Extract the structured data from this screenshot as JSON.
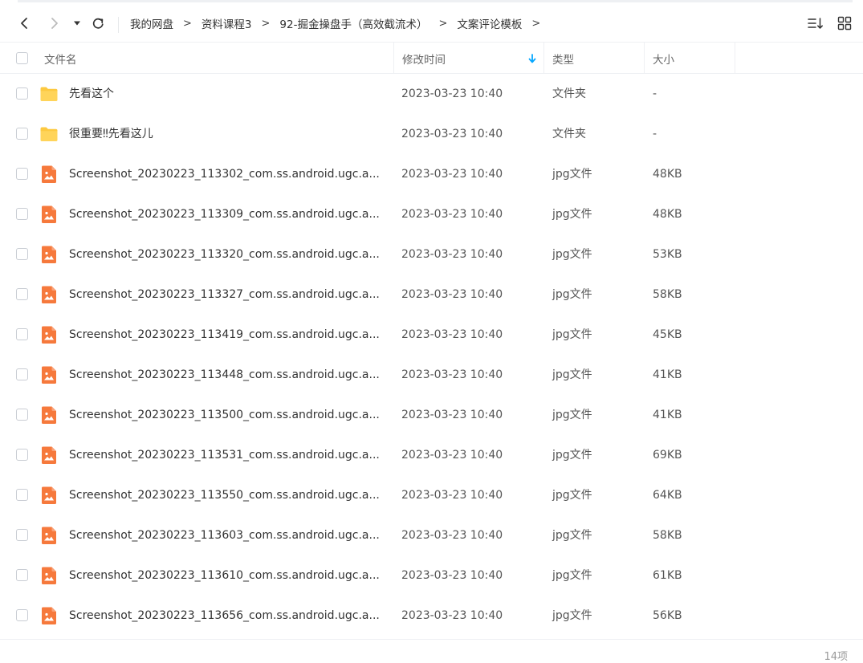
{
  "toolbar": {
    "back_icon": "chevron-left-icon",
    "forward_icon": "chevron-right-icon",
    "dropdown_icon": "caret-down-icon",
    "refresh_icon": "refresh-icon",
    "sort_icon": "sort-list-icon",
    "grid_icon": "grid-view-icon"
  },
  "breadcrumb": [
    {
      "label": "我的网盘"
    },
    {
      "label": "资料课程3"
    },
    {
      "label": "92-掘金操盘手（高效截流术）"
    },
    {
      "label": "文案评论模板"
    }
  ],
  "header": {
    "name": "文件名",
    "modified": "修改时间",
    "type": "类型",
    "size": "大小",
    "sort_indicator": "arrow-down-icon",
    "accent": "#06a7ff"
  },
  "files": [
    {
      "name": "先看这个",
      "date": "2023-03-23 10:40",
      "type": "文件夹",
      "size": "-",
      "icon": "folder-icon"
    },
    {
      "name": "很重要‼先看这儿",
      "date": "2023-03-23 10:40",
      "type": "文件夹",
      "size": "-",
      "icon": "folder-icon"
    },
    {
      "name": "Screenshot_20230223_113302_com.ss.android.ugc.a...",
      "date": "2023-03-23 10:40",
      "type": "jpg文件",
      "size": "48KB",
      "icon": "image-file-icon"
    },
    {
      "name": "Screenshot_20230223_113309_com.ss.android.ugc.a...",
      "date": "2023-03-23 10:40",
      "type": "jpg文件",
      "size": "48KB",
      "icon": "image-file-icon"
    },
    {
      "name": "Screenshot_20230223_113320_com.ss.android.ugc.a...",
      "date": "2023-03-23 10:40",
      "type": "jpg文件",
      "size": "53KB",
      "icon": "image-file-icon"
    },
    {
      "name": "Screenshot_20230223_113327_com.ss.android.ugc.a...",
      "date": "2023-03-23 10:40",
      "type": "jpg文件",
      "size": "58KB",
      "icon": "image-file-icon"
    },
    {
      "name": "Screenshot_20230223_113419_com.ss.android.ugc.a...",
      "date": "2023-03-23 10:40",
      "type": "jpg文件",
      "size": "45KB",
      "icon": "image-file-icon"
    },
    {
      "name": "Screenshot_20230223_113448_com.ss.android.ugc.a...",
      "date": "2023-03-23 10:40",
      "type": "jpg文件",
      "size": "41KB",
      "icon": "image-file-icon"
    },
    {
      "name": "Screenshot_20230223_113500_com.ss.android.ugc.a...",
      "date": "2023-03-23 10:40",
      "type": "jpg文件",
      "size": "41KB",
      "icon": "image-file-icon"
    },
    {
      "name": "Screenshot_20230223_113531_com.ss.android.ugc.a...",
      "date": "2023-03-23 10:40",
      "type": "jpg文件",
      "size": "69KB",
      "icon": "image-file-icon"
    },
    {
      "name": "Screenshot_20230223_113550_com.ss.android.ugc.a...",
      "date": "2023-03-23 10:40",
      "type": "jpg文件",
      "size": "64KB",
      "icon": "image-file-icon"
    },
    {
      "name": "Screenshot_20230223_113603_com.ss.android.ugc.a...",
      "date": "2023-03-23 10:40",
      "type": "jpg文件",
      "size": "58KB",
      "icon": "image-file-icon"
    },
    {
      "name": "Screenshot_20230223_113610_com.ss.android.ugc.a...",
      "date": "2023-03-23 10:40",
      "type": "jpg文件",
      "size": "61KB",
      "icon": "image-file-icon"
    },
    {
      "name": "Screenshot_20230223_113656_com.ss.android.ugc.a...",
      "date": "2023-03-23 10:40",
      "type": "jpg文件",
      "size": "56KB",
      "icon": "image-file-icon"
    }
  ],
  "footer": {
    "count": "14项"
  },
  "colors": {
    "folder": "#fdc940",
    "image_file": "#f6793c",
    "text": "#333333",
    "muted": "#999999"
  }
}
